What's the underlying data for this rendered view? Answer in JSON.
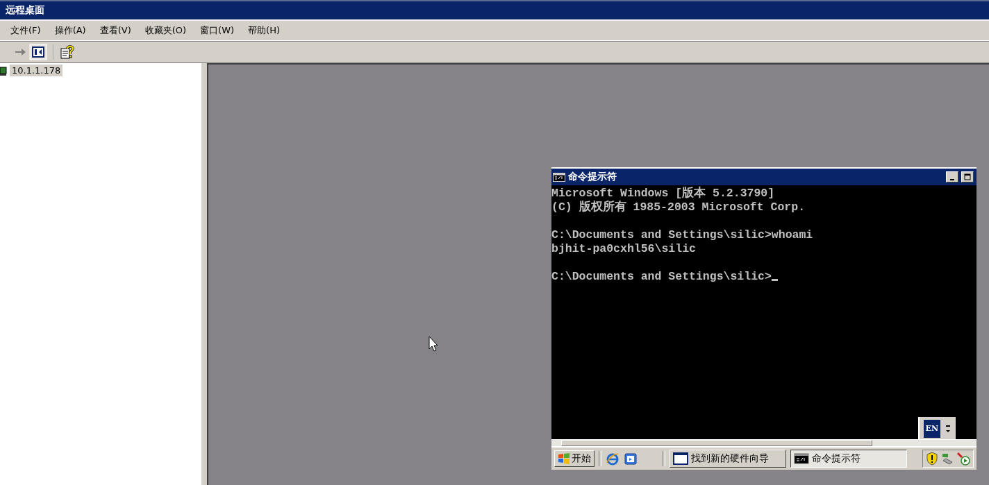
{
  "window": {
    "title": "远程桌面"
  },
  "menu": [
    {
      "label": "文件(F)"
    },
    {
      "label": "操作(A)"
    },
    {
      "label": "查看(V)"
    },
    {
      "label": "收藏夹(O)"
    },
    {
      "label": "窗口(W)"
    },
    {
      "label": "帮助(H)"
    }
  ],
  "tree": {
    "items": [
      {
        "label": "10.1.1.178",
        "selected": true
      }
    ]
  },
  "remote": {
    "console": {
      "title": "命令提示符",
      "paragraphs": [
        [
          "Microsoft Windows [版本 5.2.3790]",
          "(C) 版权所有 1985-2003 Microsoft Corp."
        ],
        [
          "C:\\Documents and Settings\\silic>whoami",
          "bjhit-pa0cxhl56\\silic"
        ],
        [
          "C:\\Documents and Settings\\silic>"
        ]
      ]
    },
    "language_bar": {
      "label": "EN"
    },
    "taskbar": {
      "start": "开始",
      "tasks": [
        {
          "label": "找到新的硬件向导",
          "kind": "window",
          "selected": false
        },
        {
          "label": "命令提示符",
          "kind": "console",
          "selected": true
        }
      ]
    }
  }
}
